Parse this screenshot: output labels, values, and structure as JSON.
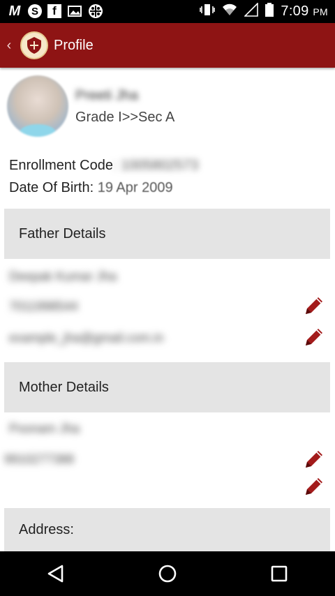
{
  "status_bar": {
    "apps": [
      "M",
      "S",
      "f"
    ],
    "time": "7:09",
    "ampm": "PM"
  },
  "app_bar": {
    "back": "‹",
    "title": "Profile"
  },
  "profile": {
    "name": "Preeti Jha",
    "grade": "Grade I>>Sec A",
    "enrollment_label": "Enrollment Code",
    "enrollment_value": ": 1005802573",
    "dob_label": "Date Of Birth:",
    "dob_value": " 19 Apr 2009"
  },
  "father": {
    "heading": "Father Details",
    "name": "Deepak Kumar Jha",
    "phone": "7011998544",
    "email": "example_jha@gmail.com.in"
  },
  "mother": {
    "heading": "Mother Details",
    "name": "Poonam Jha",
    "phone": "9910277388"
  },
  "address": {
    "heading": "Address:"
  },
  "colors": {
    "appbar": "#8e1414",
    "edit_icon": "#a31b1b",
    "section_bg": "#e4e4e4"
  },
  "icons": {
    "edit": "pencil-icon",
    "back": "back-arrow-icon"
  }
}
